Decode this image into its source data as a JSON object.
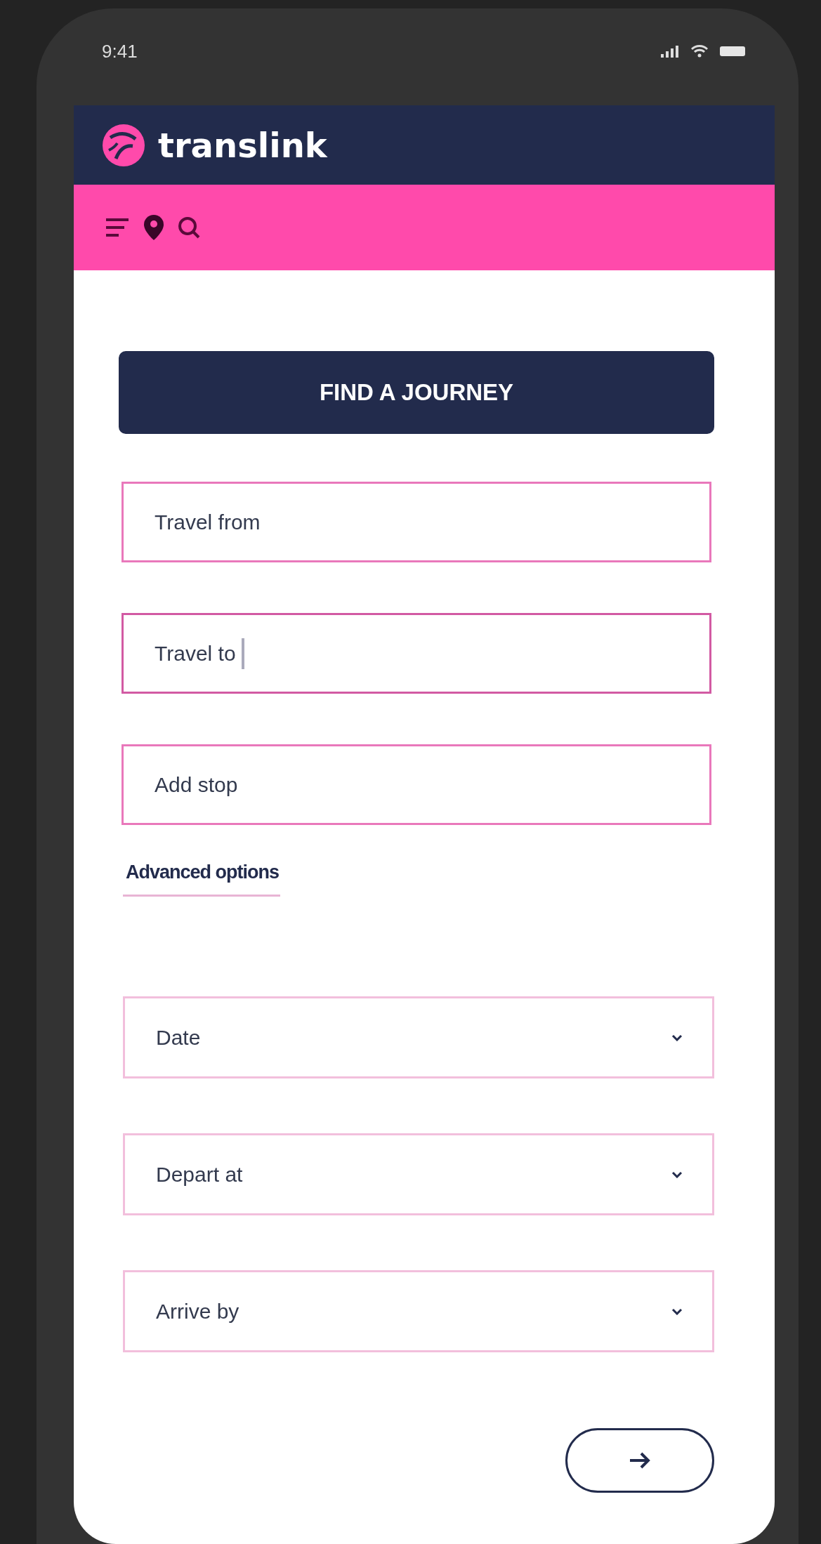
{
  "status_bar": {
    "time": "9:41"
  },
  "header": {
    "brand": "translink"
  },
  "title_button": "FIND A JOURNEY",
  "fields": [
    {
      "placeholder": "Travel from",
      "focused": false
    },
    {
      "placeholder": "Travel to",
      "focused": true
    },
    {
      "placeholder": "Add stop",
      "focused": false
    }
  ],
  "advanced_link": "Advanced options",
  "dropdowns": [
    {
      "placeholder": "Date"
    },
    {
      "placeholder": "Depart at"
    },
    {
      "placeholder": "Arrive by"
    }
  ]
}
